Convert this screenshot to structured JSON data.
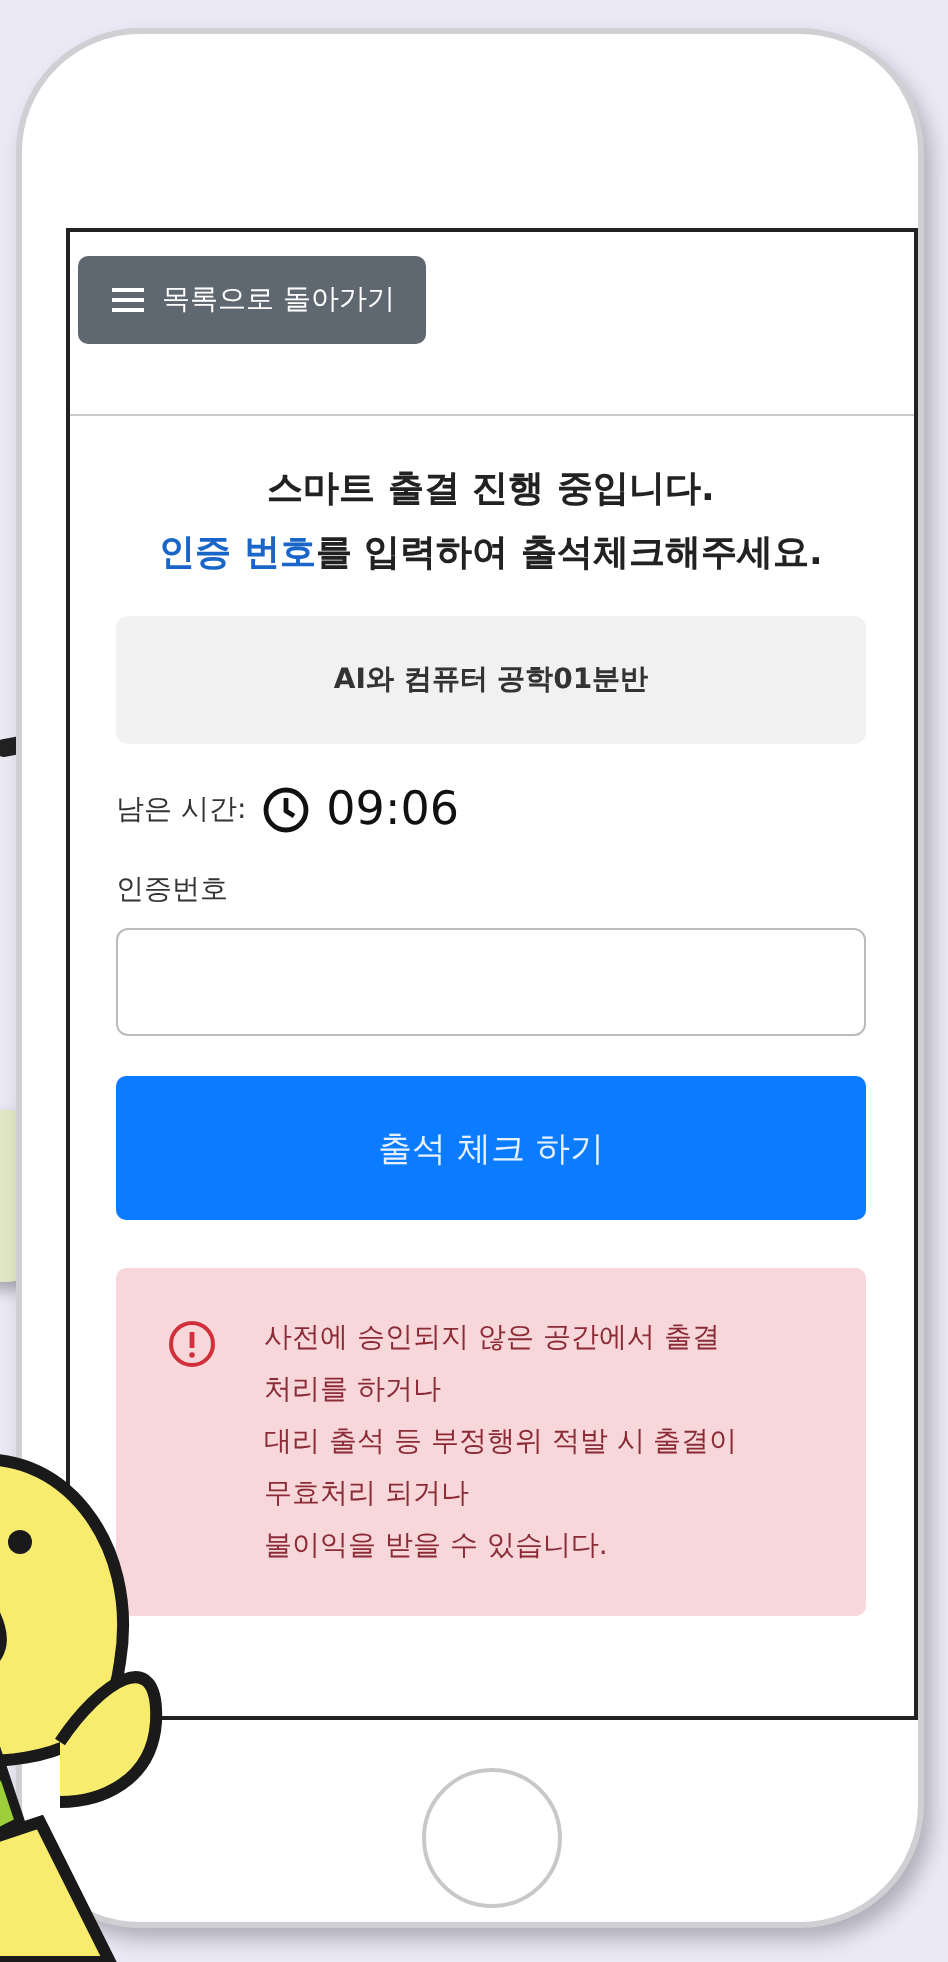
{
  "back_button": {
    "label": "목록으로 돌아가기"
  },
  "heading": {
    "line_1": "스마트 출결 진행 중입니다.",
    "line_2": [
      {
        "text": "인증 번호",
        "highlight": true
      },
      {
        "text": "를 입력하여 출석체크해주세요.",
        "highlight": false
      }
    ]
  },
  "course": {
    "name": "AI와 컴퓨터 공학01분반"
  },
  "timer": {
    "label": "남은 시간:",
    "value": "09:06"
  },
  "code_field": {
    "label": "인증번호"
  },
  "submit_button": {
    "label": "출석 체크 하기"
  },
  "warning": {
    "text": "사전에 승인되지 않은 공간에서 출결 처리를 하거나\n대리 출석 등 부정행위 적발 시 출결이 무효처리 되거나\n불이익을 받을 수 있습니다."
  }
}
